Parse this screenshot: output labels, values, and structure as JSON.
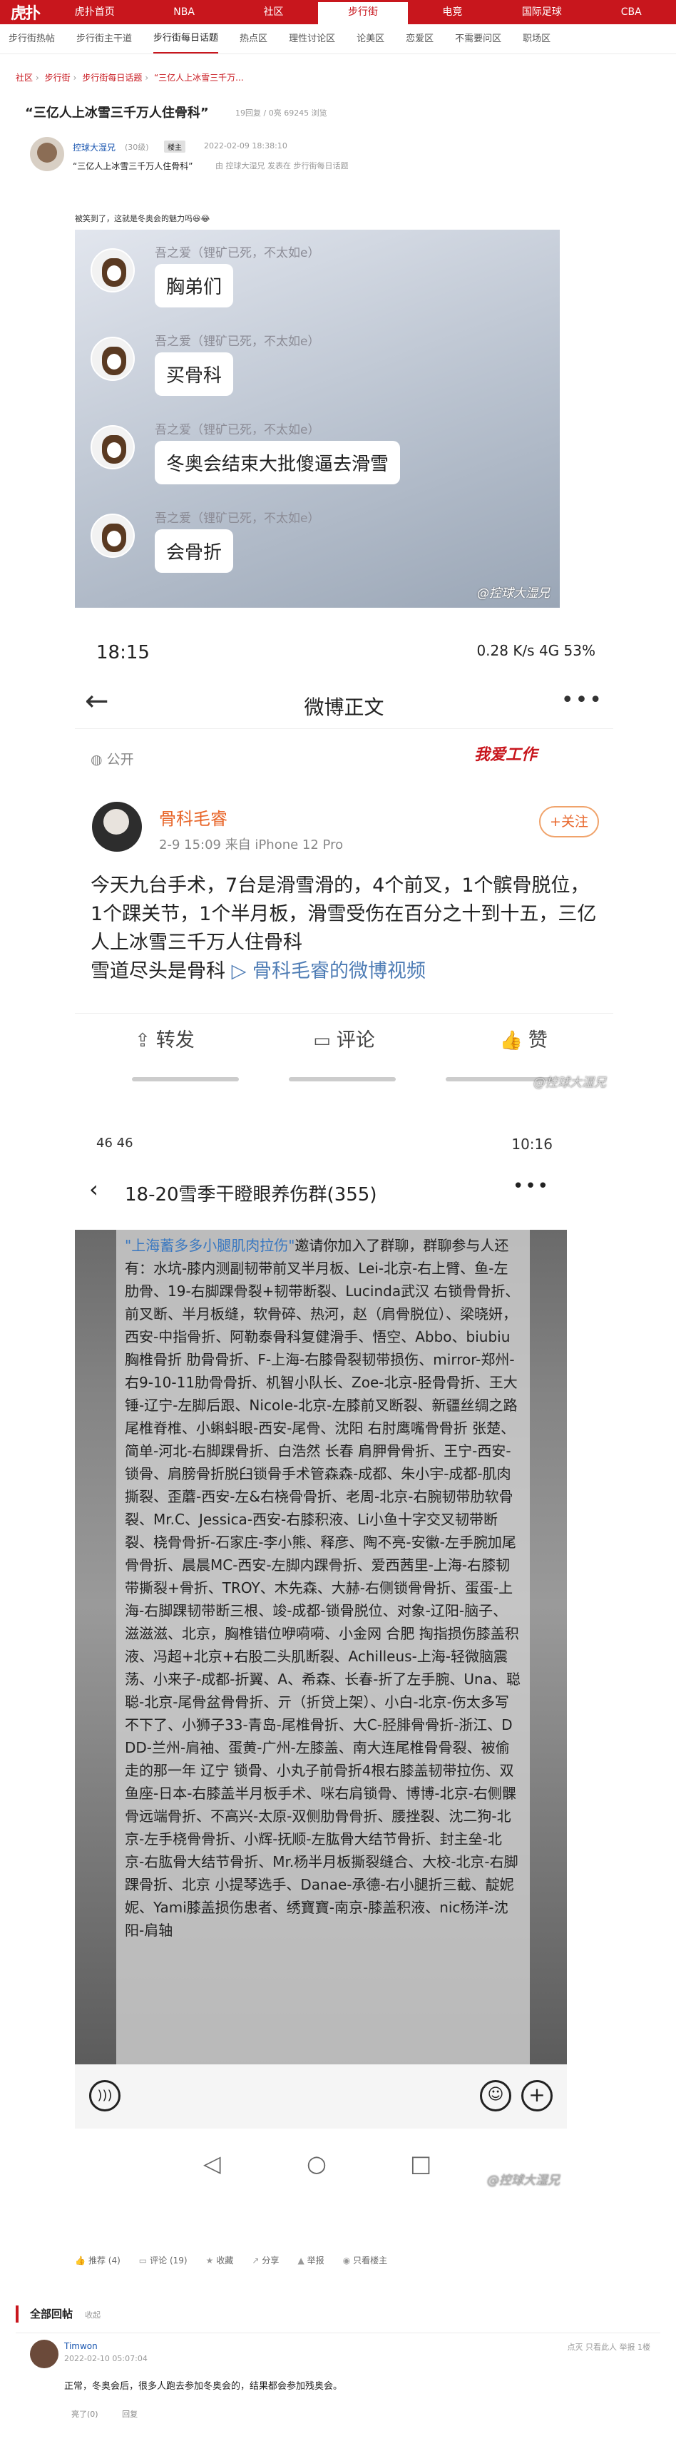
{
  "topnav": {
    "logo": "虎扑",
    "items": [
      "虎扑首页",
      "NBA",
      "社区",
      "步行街",
      "电竞",
      "国际足球",
      "CBA"
    ],
    "active_index": 3
  },
  "subnav": {
    "items": [
      "步行街热帖",
      "步行街主干道",
      "步行街每日话题",
      "热点区",
      "理性讨论区",
      "论美区",
      "恋爱区",
      "不需要问区",
      "职场区"
    ],
    "active_index": 2
  },
  "breadcrumb": [
    "社区",
    "步行街",
    "步行街每日话题",
    "“三亿人上冰雪三千万..."
  ],
  "post": {
    "title": "“三亿人上冰雪三千万人住骨科”",
    "meta": "19回复 / 0亮 69245 浏览",
    "author_name": "控球大湿兄",
    "author_level": "(30级)",
    "author_badge": "楼主",
    "time": "2022-02-09 18:38:10",
    "reply_name": "“三亿人上冰雪三千万人住骨科”",
    "reply_source": "由 控球大湿兄 发表在 步行街每日话题",
    "body_line": "被笑到了，这就是冬奥会的魅力吗😆😂"
  },
  "image1": {
    "messages": [
      {
        "name": "吾之爱（锂矿已死，不太如e）",
        "text": "胸弟们"
      },
      {
        "name": "吾之爱（锂矿已死，不太如e）",
        "text": "买骨科"
      },
      {
        "name": "吾之爱（锂矿已死，不太如e）",
        "text": "冬奥会结束大批傻逼去滑雪"
      },
      {
        "name": "吾之爱（锂矿已死，不太如e）",
        "text": "会骨折"
      }
    ],
    "watermark": "@控球大湿兄"
  },
  "image2": {
    "status_time": "18:15",
    "status_right": "0.28 K/s  4G 53%",
    "header_title": "微博正文",
    "visibility": "公开",
    "stamp": "我爱工作",
    "user_name": "骨科毛睿",
    "user_meta": "2-9 15:09  来自 iPhone 12 Pro",
    "follow_label": "+关注",
    "body_text": "今天九台手术，7台是滑雪滑的，4个前叉，1个髌骨脱位，1个踝关节，1个半月板，滑雪受伤在百分之十到十五，三亿人上冰雪三千万人住骨科",
    "body_tail": "雪道尽头是骨科",
    "video_link": "骨科毛睿的微博视频",
    "actions": [
      "转发",
      "评论",
      "赞"
    ],
    "watermark": "@控球大湿兄"
  },
  "image3": {
    "status_left": "46 46",
    "status_time": "10:16",
    "group_title": "18-20雪季干瞪眼养伤群(355)",
    "notice_prefix": "\"上海蓄多多小腿肌肉拉伤\"",
    "notice_text": "邀请你加入了群聊，群聊参与人还有：水坑-膝内测副韧带前叉半月板、Lei-北京-右上臂、鱼-左肋骨、19-右脚踝骨裂+韧带断裂、Lucinda武汉 右锁骨骨折、前叉断、半月板缝，软骨碎、热河，赵（肩骨脱位）、梁晓妍，西安-中指骨折、阿勒泰骨科复健滑手、悟空、Abbo、biubiu胸椎骨折 肋骨骨折、F-上海-右膝骨裂韧带损伤、mirror-郑州-右9-10-11肋骨骨折、机智小队长、Zoe-北京-胫骨骨折、王大锤-辽宁-左脚后跟、Nicole-北京-左膝前叉断裂、新疆丝绸之路 尾椎脊椎、小蝌蚪眼-西安-尾骨、沈阳 右肘鹰嘴骨骨折 张楚、简单-河北-右脚踝骨折、白浩然 长春 肩胛骨骨折、王宁-西安-锁骨、肩膀骨折脱臼锁骨手术管森森-成都、朱小宇-成都-肌肉撕裂、歪蘑-西安-左&右桡骨骨折、老周-北京-右腕韧带肋软骨裂、Mr.C、Jessica-西安-右膝积液、Li小鱼十字交叉韧带断裂、桡骨骨折-石家庄-李小熊、释彦、陶不亮-安徽-左手腕加尾骨骨折、晨晨MC-西安-左脚内踝骨折、爱西茜里-上海-右膝韧带撕裂+骨折、TROY、木先森、大赫-右侧锁骨骨折、蛋蛋-上海-右脚踝韧带断三根、竣-成都-锁骨脱位、对象-辽阳-脑子、滋滋滋、北京，胸椎错位咿嗬嗬、小金网 合肥 掏指损伤膝盖积液、冯超+北京+右股二头肌断裂、Achilleus-上海-轻微脑震荡、小来子-成都-折翼、A、希森、长春-折了左手腕、Una、聪聪-北京-尾骨盆骨骨折、亓（折贷上架）、小白-北京-伤太多写不下了、小狮子33-青岛-尾椎骨折、大C-胫腓骨骨折-浙江、DDD-兰州-肩袖、蛋黄-广州-左膝盖、南大连尾椎骨骨裂、被偷走的那一年 辽宁 锁骨、小丸子前骨折4根右膝盖韧带拉伤、双鱼座-日本-右膝盖半月板手术、咪右肩锁骨、博博-北京-右侧髁骨远端骨折、不高兴-太原-双侧肋骨骨折、腰挫裂、沈二狗-北京-左手桡骨骨折、小辉-抚顺-左肱骨大结节骨折、封主垒-北京-右肱骨大结节骨折、Mr.杨半月板撕裂缝合、大校-北京-右脚踝骨折、北京 小提琴选手、Danae-承德-右小腿折三截、靛妮妮、Yami膝盖损伤患者、绣寶寶-南京-膝盖积液、nic杨洋-沈阳-肩轴",
    "watermark": "@控球大湿兄"
  },
  "post_actions": [
    {
      "icon": "thumb-up",
      "label": "推荐 (4)"
    },
    {
      "icon": "comment",
      "label": "评论 (19)"
    },
    {
      "icon": "star",
      "label": "收藏"
    },
    {
      "icon": "share",
      "label": "分享"
    },
    {
      "icon": "warning",
      "label": "举报"
    },
    {
      "icon": "eye",
      "label": "只看楼主"
    }
  ],
  "replies_header": {
    "title": "全部回帖",
    "collapse": "收起"
  },
  "reply": {
    "name": "Timwon",
    "time": "2022-02-10 05:07:04",
    "ops": "点灭  只看此人  举报  1楼",
    "text": "正常，冬奥会后，很多人跑去参加冬奥会的，结果都会参加残奥会。",
    "light": "亮了(0)",
    "reply_btn": "回复"
  }
}
